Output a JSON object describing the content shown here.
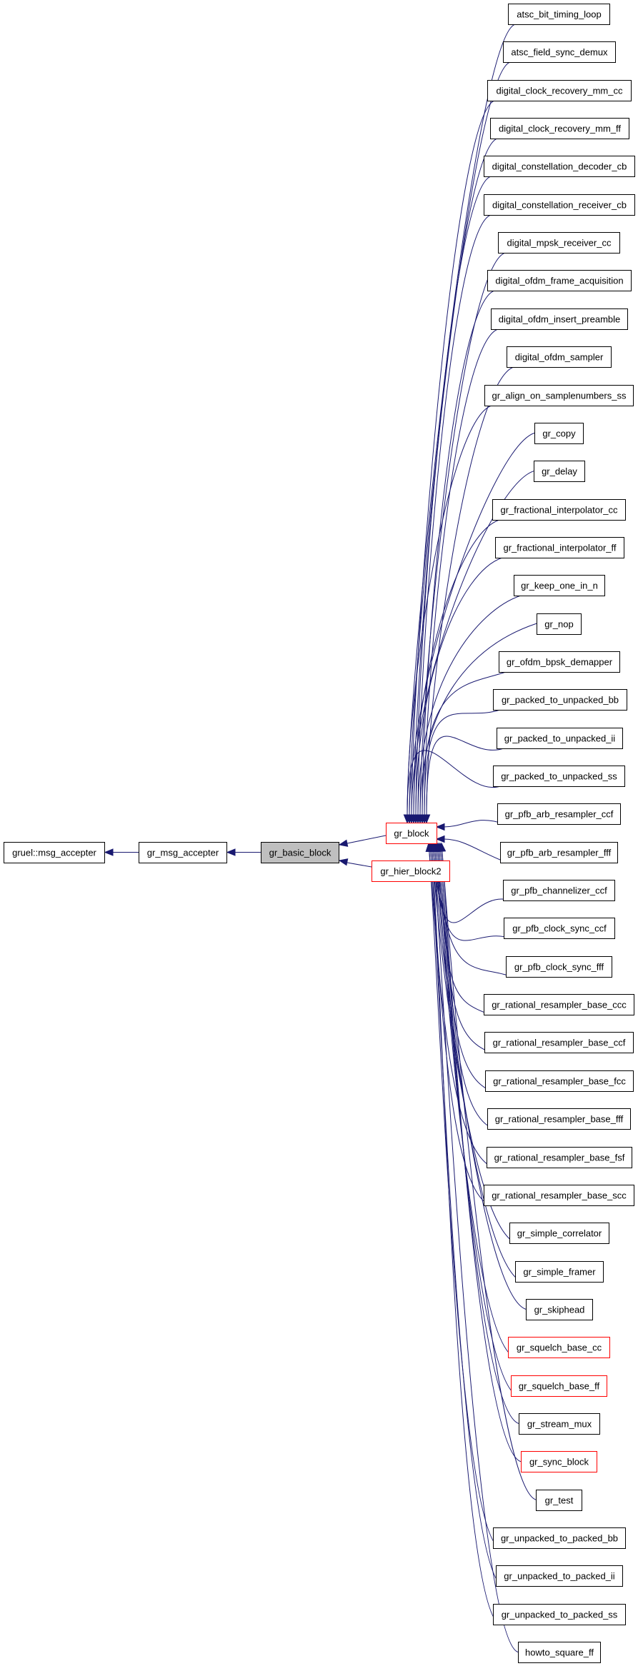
{
  "diagram": {
    "type": "inheritance-graph",
    "edge_color": "#191970",
    "current_fill": "#bfbfbf",
    "red_border": "#ff0000",
    "ancestors": [
      {
        "id": "gruel_msg_accepter",
        "label": "gruel::msg_accepter"
      },
      {
        "id": "gr_msg_accepter",
        "label": "gr_msg_accepter"
      }
    ],
    "current": {
      "id": "gr_basic_block",
      "label": "gr_basic_block"
    },
    "children": [
      {
        "id": "gr_block",
        "label": "gr_block",
        "red_border": true
      },
      {
        "id": "gr_hier_block2",
        "label": "gr_hier_block2",
        "red_border": true
      }
    ],
    "grandchildren_parent": "gr_block",
    "grandchildren": [
      {
        "label": "atsc_bit_timing_loop",
        "red_border": false
      },
      {
        "label": "atsc_field_sync_demux",
        "red_border": false
      },
      {
        "label": "digital_clock_recovery_mm_cc",
        "red_border": false
      },
      {
        "label": "digital_clock_recovery_mm_ff",
        "red_border": false
      },
      {
        "label": "digital_constellation_decoder_cb",
        "red_border": false
      },
      {
        "label": "digital_constellation_receiver_cb",
        "red_border": false
      },
      {
        "label": "digital_mpsk_receiver_cc",
        "red_border": false
      },
      {
        "label": "digital_ofdm_frame_acquisition",
        "red_border": false
      },
      {
        "label": "digital_ofdm_insert_preamble",
        "red_border": false
      },
      {
        "label": "digital_ofdm_sampler",
        "red_border": false
      },
      {
        "label": "gr_align_on_samplenumbers_ss",
        "red_border": false
      },
      {
        "label": "gr_copy",
        "red_border": false
      },
      {
        "label": "gr_delay",
        "red_border": false
      },
      {
        "label": "gr_fractional_interpolator_cc",
        "red_border": false
      },
      {
        "label": "gr_fractional_interpolator_ff",
        "red_border": false
      },
      {
        "label": "gr_keep_one_in_n",
        "red_border": false
      },
      {
        "label": "gr_nop",
        "red_border": false
      },
      {
        "label": "gr_ofdm_bpsk_demapper",
        "red_border": false
      },
      {
        "label": "gr_packed_to_unpacked_bb",
        "red_border": false
      },
      {
        "label": "gr_packed_to_unpacked_ii",
        "red_border": false
      },
      {
        "label": "gr_packed_to_unpacked_ss",
        "red_border": false
      },
      {
        "label": "gr_pfb_arb_resampler_ccf",
        "red_border": false
      },
      {
        "label": "gr_pfb_arb_resampler_fff",
        "red_border": false
      },
      {
        "label": "gr_pfb_channelizer_ccf",
        "red_border": false
      },
      {
        "label": "gr_pfb_clock_sync_ccf",
        "red_border": false
      },
      {
        "label": "gr_pfb_clock_sync_fff",
        "red_border": false
      },
      {
        "label": "gr_rational_resampler_base_ccc",
        "red_border": false
      },
      {
        "label": "gr_rational_resampler_base_ccf",
        "red_border": false
      },
      {
        "label": "gr_rational_resampler_base_fcc",
        "red_border": false
      },
      {
        "label": "gr_rational_resampler_base_fff",
        "red_border": false
      },
      {
        "label": "gr_rational_resampler_base_fsf",
        "red_border": false
      },
      {
        "label": "gr_rational_resampler_base_scc",
        "red_border": false
      },
      {
        "label": "gr_simple_correlator",
        "red_border": false
      },
      {
        "label": "gr_simple_framer",
        "red_border": false
      },
      {
        "label": "gr_skiphead",
        "red_border": false
      },
      {
        "label": "gr_squelch_base_cc",
        "red_border": true
      },
      {
        "label": "gr_squelch_base_ff",
        "red_border": true
      },
      {
        "label": "gr_stream_mux",
        "red_border": false
      },
      {
        "label": "gr_sync_block",
        "red_border": true
      },
      {
        "label": "gr_test",
        "red_border": false
      },
      {
        "label": "gr_unpacked_to_packed_bb",
        "red_border": false
      },
      {
        "label": "gr_unpacked_to_packed_ii",
        "red_border": false
      },
      {
        "label": "gr_unpacked_to_packed_ss",
        "red_border": false
      },
      {
        "label": "howto_square_ff",
        "red_border": false
      }
    ]
  }
}
